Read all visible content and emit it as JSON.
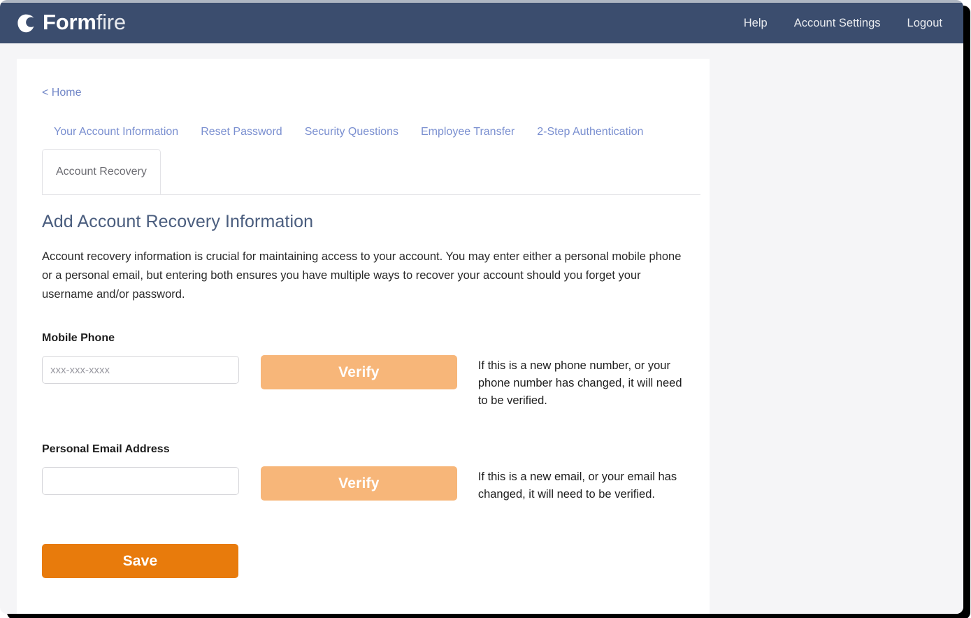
{
  "brand": {
    "name_bold": "Form",
    "name_light": "fire",
    "logo_icon": "flame-logo-icon"
  },
  "header": {
    "nav": [
      {
        "label": "Help",
        "name": "help"
      },
      {
        "label": "Account Settings",
        "name": "account-settings"
      },
      {
        "label": "Logout",
        "name": "logout"
      }
    ]
  },
  "breadcrumb": {
    "label": "< Home"
  },
  "tabs": {
    "links": [
      {
        "label": "Your Account Information",
        "name": "your-account-information"
      },
      {
        "label": "Reset Password",
        "name": "reset-password"
      },
      {
        "label": "Security Questions",
        "name": "security-questions"
      },
      {
        "label": "Employee Transfer",
        "name": "employee-transfer"
      },
      {
        "label": "2-Step Authentication",
        "name": "2-step-authentication"
      }
    ],
    "active": {
      "label": "Account Recovery",
      "name": "account-recovery"
    }
  },
  "main": {
    "title": "Add Account Recovery Information",
    "description": "Account recovery information is crucial for maintaining access to your account. You may enter either a personal mobile phone or a personal email, but entering both ensures you have multiple ways to recover your account should you forget your username and/or password.",
    "phone": {
      "label": "Mobile Phone",
      "placeholder": "xxx-xxx-xxxx",
      "value": "",
      "verify_label": "Verify",
      "hint": "If this is a new phone number, or your phone number has changed, it will need to be verified."
    },
    "email": {
      "label": "Personal Email Address",
      "placeholder": "",
      "value": "",
      "verify_label": "Verify",
      "hint": "If this is a new email, or your email has changed, it will need to be verified."
    },
    "save_label": "Save"
  },
  "colors": {
    "header_navy": "#3b4d6e",
    "link_blue": "#7a8fd0",
    "save_orange": "#e87b0c",
    "verify_orange": "#f7b679",
    "title_slate": "#4a5d7e"
  }
}
